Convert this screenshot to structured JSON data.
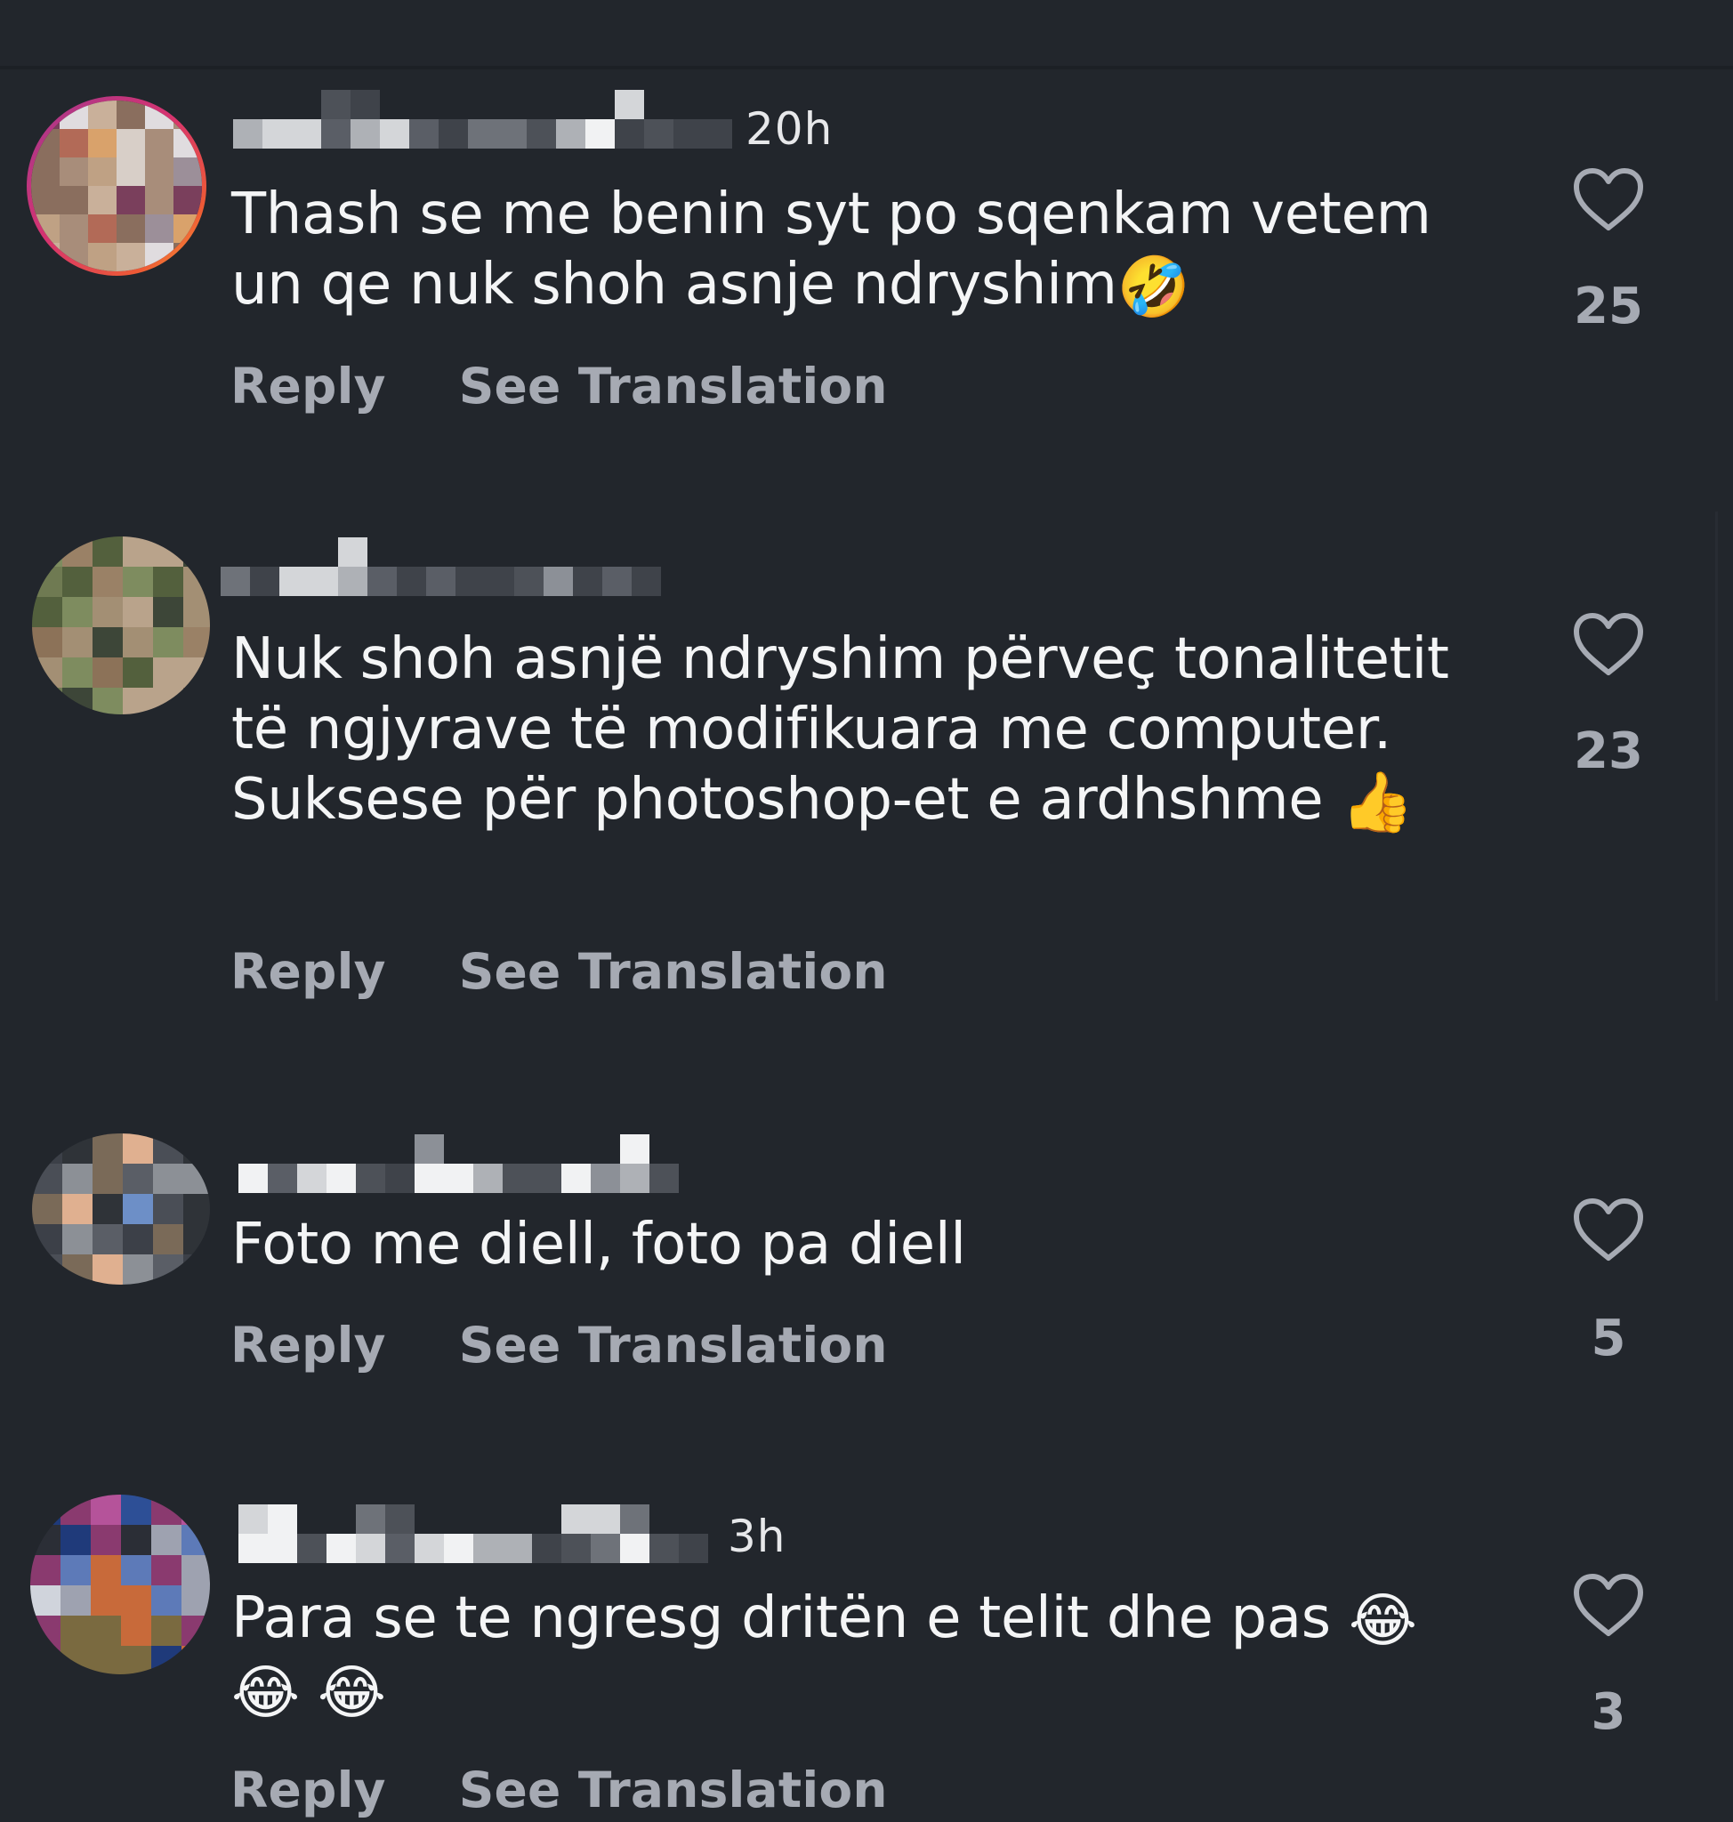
{
  "theme": {
    "background": "#22262c",
    "text_primary": "#f4f5f6",
    "text_secondary": "#a6aab3",
    "avatar_ring_gradient": [
      "#a2388f",
      "#d63370",
      "#ee5a35",
      "#f9b234"
    ]
  },
  "icons": {
    "like": "heart-outline-icon",
    "top": "chevron-down-icon"
  },
  "comments": [
    {
      "timestamp": "20h",
      "text": "Thash se me benin syt po sqenkam vetem un qe nuk shoh asnje ndryshim",
      "emoji": [
        "🤣"
      ],
      "reply_label": "Reply",
      "translate_label": "See Translation",
      "like_count": "25",
      "has_story_ring": true
    },
    {
      "timestamp": "",
      "text": "Nuk shoh asnjë ndryshim përveç tonalitetit të ngjyrave të modifikuara me computer. Suksese për photoshop-et e ardhshme",
      "emoji": [
        "👍"
      ],
      "reply_label": "Reply",
      "translate_label": "See Translation",
      "like_count": "23",
      "has_story_ring": false
    },
    {
      "timestamp": "",
      "text": "Foto me diell, foto pa diell",
      "emoji": [],
      "reply_label": "Reply",
      "translate_label": "See Translation",
      "like_count": "5",
      "has_story_ring": false
    },
    {
      "timestamp": "3h",
      "text": "Para se te ngresg dritën e telit dhe pas",
      "emoji": [
        "😂",
        "😂",
        "😂"
      ],
      "reply_label": "Reply",
      "translate_label": "See Translation",
      "like_count": "3",
      "has_story_ring": false
    }
  ]
}
